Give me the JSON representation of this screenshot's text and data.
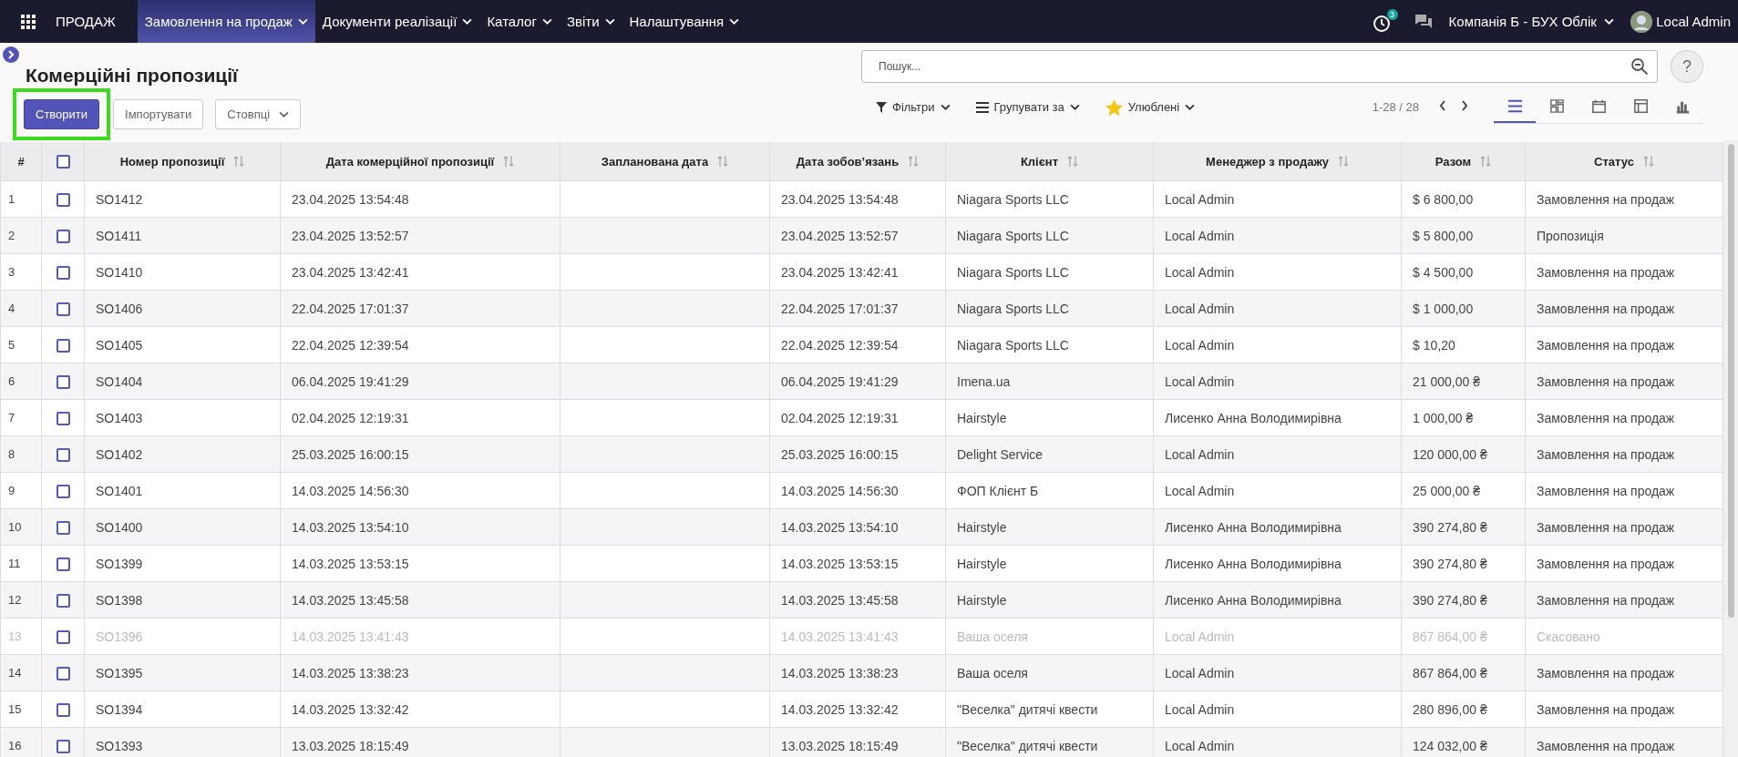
{
  "navbar": {
    "app_name": "ПРОДАЖ",
    "menus": [
      {
        "label": "Замовлення на продаж",
        "selected": true
      },
      {
        "label": "Документи реалізації",
        "selected": false
      },
      {
        "label": "Каталог",
        "selected": false
      },
      {
        "label": "Звіти",
        "selected": false
      },
      {
        "label": "Налаштування",
        "selected": false
      }
    ],
    "activity_count": "3",
    "company": "Компанія Б - БУХ Облік",
    "user": "Local Admin"
  },
  "control_panel": {
    "title": "Комерційні пропозиції",
    "create_button": {
      "label": "Створити",
      "highlighted": true
    },
    "import_button": "Імпортувати",
    "columns_button": "Стовпці",
    "search": {
      "placeholder": "Пошук..."
    },
    "help": "?",
    "filters": "Фільтри",
    "group_by": "Групувати за",
    "favorites": "Улюблені",
    "pager": "1-28 / 28",
    "views": [
      {
        "kind": "list",
        "selected": true
      },
      {
        "kind": "kanban",
        "selected": false
      },
      {
        "kind": "calendar",
        "selected": false
      },
      {
        "kind": "pivot",
        "selected": false
      },
      {
        "kind": "graph",
        "selected": false
      }
    ]
  },
  "table": {
    "columns": [
      "#",
      "Номер пропозиції",
      "Дата комерційної пропозиції",
      "Запланована дата",
      "Дата зобов’язань",
      "Клієнт",
      "Менеджер з продажу",
      "Разом",
      "Статус"
    ],
    "all_checked": false,
    "rows": [
      {
        "num": "1",
        "number": "SO1412",
        "date": "23.04.2025 13:54:48",
        "commitment": "23.04.2025 13:54:48",
        "client": "Niagara Sports LLC",
        "manager": "Local Admin",
        "total": "$ 6 800,00",
        "status": "Замовлення на продаж",
        "checked": false,
        "cancelled": false
      },
      {
        "num": "2",
        "number": "SO1411",
        "date": "23.04.2025 13:52:57",
        "commitment": "23.04.2025 13:52:57",
        "client": "Niagara Sports LLC",
        "manager": "Local Admin",
        "total": "$ 5 800,00",
        "status": "Пропозиція",
        "checked": false,
        "cancelled": false
      },
      {
        "num": "3",
        "number": "SO1410",
        "date": "23.04.2025 13:42:41",
        "commitment": "23.04.2025 13:42:41",
        "client": "Niagara Sports LLC",
        "manager": "Local Admin",
        "total": "$ 4 500,00",
        "status": "Замовлення на продаж",
        "checked": false,
        "cancelled": false
      },
      {
        "num": "4",
        "number": "SO1406",
        "date": "22.04.2025 17:01:37",
        "commitment": "22.04.2025 17:01:37",
        "client": "Niagara Sports LLC",
        "manager": "Local Admin",
        "total": "$ 1 000,00",
        "status": "Замовлення на продаж",
        "checked": false,
        "cancelled": false
      },
      {
        "num": "5",
        "number": "SO1405",
        "date": "22.04.2025 12:39:54",
        "commitment": "22.04.2025 12:39:54",
        "client": "Niagara Sports LLC",
        "manager": "Local Admin",
        "total": "$ 10,20",
        "status": "Замовлення на продаж",
        "checked": false,
        "cancelled": false
      },
      {
        "num": "6",
        "number": "SO1404",
        "date": "06.04.2025 19:41:29",
        "commitment": "06.04.2025 19:41:29",
        "client": "Imena.ua",
        "manager": "Local Admin",
        "total": "21 000,00 ₴",
        "status": "Замовлення на продаж",
        "checked": false,
        "cancelled": false
      },
      {
        "num": "7",
        "number": "SO1403",
        "date": "02.04.2025 12:19:31",
        "commitment": "02.04.2025 12:19:31",
        "client": "Hairstyle",
        "manager": "Лисенко Анна Володимирівна",
        "total": "1 000,00 ₴",
        "status": "Замовлення на продаж",
        "checked": false,
        "cancelled": false
      },
      {
        "num": "8",
        "number": "SO1402",
        "date": "25.03.2025 16:00:15",
        "commitment": "25.03.2025 16:00:15",
        "client": "Delight Service",
        "manager": "Local Admin",
        "total": "120 000,00 ₴",
        "status": "Замовлення на продаж",
        "checked": false,
        "cancelled": false
      },
      {
        "num": "9",
        "number": "SO1401",
        "date": "14.03.2025 14:56:30",
        "commitment": "14.03.2025 14:56:30",
        "client": "ФОП Клієнт Б",
        "manager": "Local Admin",
        "total": "25 000,00 ₴",
        "status": "Замовлення на продаж",
        "checked": false,
        "cancelled": false
      },
      {
        "num": "10",
        "number": "SO1400",
        "date": "14.03.2025 13:54:10",
        "commitment": "14.03.2025 13:54:10",
        "client": "Hairstyle",
        "manager": "Лисенко Анна Володимирівна",
        "total": "390 274,80 ₴",
        "status": "Замовлення на продаж",
        "checked": false,
        "cancelled": false
      },
      {
        "num": "11",
        "number": "SO1399",
        "date": "14.03.2025 13:53:15",
        "commitment": "14.03.2025 13:53:15",
        "client": "Hairstyle",
        "manager": "Лисенко Анна Володимирівна",
        "total": "390 274,80 ₴",
        "status": "Замовлення на продаж",
        "checked": false,
        "cancelled": false
      },
      {
        "num": "12",
        "number": "SO1398",
        "date": "14.03.2025 13:45:58",
        "commitment": "14.03.2025 13:45:58",
        "client": "Hairstyle",
        "manager": "Лисенко Анна Володимирівна",
        "total": "390 274,80 ₴",
        "status": "Замовлення на продаж",
        "checked": false,
        "cancelled": false
      },
      {
        "num": "13",
        "number": "SO1396",
        "date": "14.03.2025 13:41:43",
        "commitment": "14.03.2025 13:41:43",
        "client": "Ваша оселя",
        "manager": "Local Admin",
        "total": "867 864,00 ₴",
        "status": "Скасовано",
        "checked": false,
        "cancelled": true
      },
      {
        "num": "14",
        "number": "SO1395",
        "date": "14.03.2025 13:38:23",
        "commitment": "14.03.2025 13:38:23",
        "client": "Ваша оселя",
        "manager": "Local Admin",
        "total": "867 864,00 ₴",
        "status": "Замовлення на продаж",
        "checked": false,
        "cancelled": false
      },
      {
        "num": "15",
        "number": "SO1394",
        "date": "14.03.2025 13:32:42",
        "commitment": "14.03.2025 13:32:42",
        "client": "\"Веселка\" дитячі квести",
        "manager": "Local Admin",
        "total": "280 896,00 ₴",
        "status": "Замовлення на продаж",
        "checked": false,
        "cancelled": false
      },
      {
        "num": "16",
        "number": "SO1393",
        "date": "13.03.2025 18:15:49",
        "commitment": "13.03.2025 18:15:49",
        "client": "\"Веселка\" дитячі квести",
        "manager": "Local Admin",
        "total": "124 032,00 ₴",
        "status": "Замовлення на продаж",
        "checked": false,
        "cancelled": false
      }
    ]
  }
}
